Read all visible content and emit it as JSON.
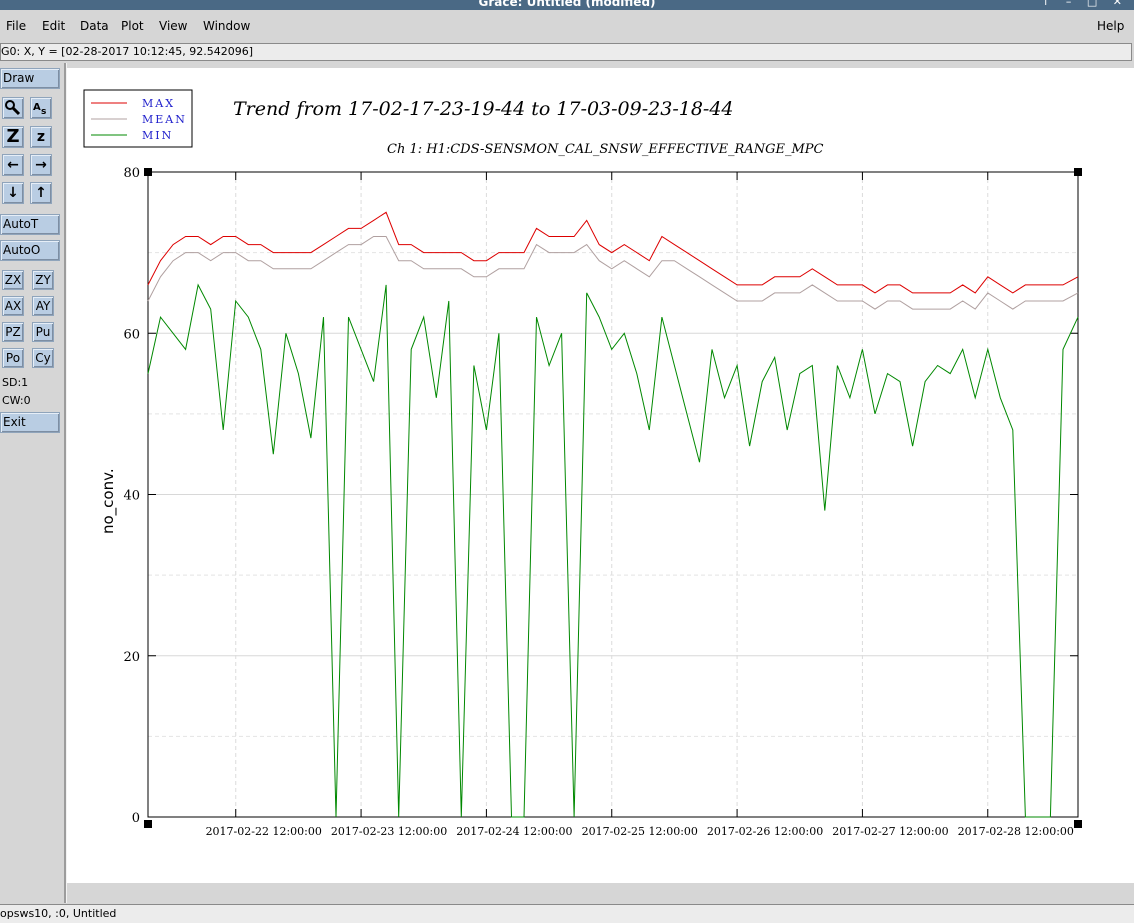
{
  "window": {
    "title": "Grace: Untitled (modified)",
    "controls": "↑ – □ ✕"
  },
  "menu": [
    "File",
    "Edit",
    "Data",
    "Plot",
    "View",
    "Window",
    "Help"
  ],
  "locator": "G0: X, Y = [02-28-2017 10:12:45, 92.542096]",
  "toolbar": {
    "draw": "Draw",
    "autoT": "AutoT",
    "autoO": "AutoO",
    "zoom_row": [
      "Z",
      "z"
    ],
    "arrows_h": [
      "←",
      "→"
    ],
    "arrows_v": [
      "↓",
      "↑"
    ],
    "zx": "ZX",
    "zy": "ZY",
    "ax": "AX",
    "ay": "AY",
    "pz": "PZ",
    "pu": "Pu",
    "po": "Po",
    "cy": "Cy",
    "sd": "SD:1",
    "cw": "CW:0",
    "exit": "Exit",
    "icon_names": [
      "magnifier-icon",
      "text-label-icon"
    ]
  },
  "status": "opsws10, :0, Untitled",
  "colors": {
    "max": "#dd0000",
    "mean": "#b0a0a0",
    "min": "#008800",
    "toolbar_button": "#b9cde3",
    "title_bar": "#4a6985"
  },
  "chart_data": {
    "type": "line",
    "title": "Trend from 17-02-17-23-19-44 to 17-03-09-23-18-44",
    "subtitle": "Ch 1: H1:CDS-SENSMON_CAL_SNSW_EFFECTIVE_RANGE_MPC",
    "xlabel": "",
    "ylabel": "no_conv.",
    "xlim": [
      0.0,
      7.42
    ],
    "ylim": [
      0,
      80
    ],
    "y_ticks": [
      0,
      20,
      40,
      60,
      80
    ],
    "x_tick_labels": [
      "2017-02-22 12:00:00",
      "2017-02-23 12:00:00",
      "2017-02-24 12:00:00",
      "2017-02-25 12:00:00",
      "2017-02-26 12:00:00",
      "2017-02-27 12:00:00",
      "2017-02-28 12:00:00"
    ],
    "x_tick_values": [
      0.7,
      1.7,
      2.7,
      3.7,
      4.7,
      5.7,
      6.7
    ],
    "grid": true,
    "legend_position": "top-left",
    "series": [
      {
        "name": "MAX",
        "x": [
          0.0,
          0.1,
          0.2,
          0.3,
          0.4,
          0.5,
          0.6,
          0.7,
          0.8,
          0.9,
          1.0,
          1.1,
          1.2,
          1.3,
          1.4,
          1.5,
          1.6,
          1.7,
          1.8,
          1.9,
          2.0,
          2.1,
          2.2,
          2.3,
          2.4,
          2.5,
          2.6,
          2.7,
          2.8,
          2.9,
          3.0,
          3.1,
          3.2,
          3.3,
          3.4,
          3.5,
          3.6,
          3.7,
          3.8,
          3.9,
          4.0,
          4.1,
          4.2,
          4.3,
          4.4,
          4.5,
          4.6,
          4.7,
          4.8,
          4.9,
          5.0,
          5.1,
          5.2,
          5.3,
          5.4,
          5.5,
          5.6,
          5.7,
          5.8,
          5.9,
          6.0,
          6.1,
          6.2,
          6.3,
          6.4,
          6.5,
          6.6,
          6.7,
          6.8,
          6.9,
          7.0,
          7.1,
          7.2,
          7.3,
          7.42
        ],
        "values": [
          66,
          69,
          71,
          72,
          72,
          71,
          72,
          72,
          71,
          71,
          70,
          70,
          70,
          70,
          71,
          72,
          73,
          73,
          74,
          75,
          71,
          71,
          70,
          70,
          70,
          70,
          69,
          69,
          70,
          70,
          70,
          73,
          72,
          72,
          72,
          74,
          71,
          70,
          71,
          70,
          69,
          72,
          71,
          70,
          69,
          68,
          67,
          66,
          66,
          66,
          67,
          67,
          67,
          68,
          67,
          66,
          66,
          66,
          65,
          66,
          66,
          65,
          65,
          65,
          65,
          66,
          65,
          67,
          66,
          65,
          66,
          66,
          66,
          66,
          67
        ]
      },
      {
        "name": "MEAN",
        "x": [
          0.0,
          0.1,
          0.2,
          0.3,
          0.4,
          0.5,
          0.6,
          0.7,
          0.8,
          0.9,
          1.0,
          1.1,
          1.2,
          1.3,
          1.4,
          1.5,
          1.6,
          1.7,
          1.8,
          1.9,
          2.0,
          2.1,
          2.2,
          2.3,
          2.4,
          2.5,
          2.6,
          2.7,
          2.8,
          2.9,
          3.0,
          3.1,
          3.2,
          3.3,
          3.4,
          3.5,
          3.6,
          3.7,
          3.8,
          3.9,
          4.0,
          4.1,
          4.2,
          4.3,
          4.4,
          4.5,
          4.6,
          4.7,
          4.8,
          4.9,
          5.0,
          5.1,
          5.2,
          5.3,
          5.4,
          5.5,
          5.6,
          5.7,
          5.8,
          5.9,
          6.0,
          6.1,
          6.2,
          6.3,
          6.4,
          6.5,
          6.6,
          6.7,
          6.8,
          6.9,
          7.0,
          7.1,
          7.2,
          7.3,
          7.42
        ],
        "values": [
          64,
          67,
          69,
          70,
          70,
          69,
          70,
          70,
          69,
          69,
          68,
          68,
          68,
          68,
          69,
          70,
          71,
          71,
          72,
          72,
          69,
          69,
          68,
          68,
          68,
          68,
          67,
          67,
          68,
          68,
          68,
          71,
          70,
          70,
          70,
          71,
          69,
          68,
          69,
          68,
          67,
          69,
          69,
          68,
          67,
          66,
          65,
          64,
          64,
          64,
          65,
          65,
          65,
          66,
          65,
          64,
          64,
          64,
          63,
          64,
          64,
          63,
          63,
          63,
          63,
          64,
          63,
          65,
          64,
          63,
          64,
          64,
          64,
          64,
          65
        ]
      },
      {
        "name": "MIN",
        "x": [
          0.0,
          0.1,
          0.2,
          0.3,
          0.4,
          0.5,
          0.6,
          0.7,
          0.8,
          0.9,
          1.0,
          1.1,
          1.2,
          1.3,
          1.4,
          1.5,
          1.6,
          1.7,
          1.8,
          1.9,
          2.0,
          2.1,
          2.2,
          2.3,
          2.4,
          2.5,
          2.6,
          2.7,
          2.8,
          2.9,
          3.0,
          3.1,
          3.2,
          3.3,
          3.4,
          3.5,
          3.6,
          3.7,
          3.8,
          3.9,
          4.0,
          4.1,
          4.2,
          4.3,
          4.4,
          4.5,
          4.6,
          4.7,
          4.8,
          4.9,
          5.0,
          5.1,
          5.2,
          5.3,
          5.4,
          5.5,
          5.6,
          5.7,
          5.8,
          5.9,
          6.0,
          6.1,
          6.2,
          6.3,
          6.4,
          6.5,
          6.6,
          6.7,
          6.8,
          6.9,
          7.0,
          7.1,
          7.2,
          7.3,
          7.42
        ],
        "values": [
          55,
          62,
          60,
          58,
          66,
          63,
          48,
          64,
          62,
          58,
          45,
          60,
          55,
          47,
          62,
          0,
          62,
          58,
          54,
          66,
          0,
          58,
          62,
          52,
          64,
          0,
          56,
          48,
          60,
          0,
          0,
          62,
          56,
          60,
          0,
          65,
          62,
          58,
          60,
          55,
          48,
          62,
          56,
          50,
          44,
          58,
          52,
          56,
          46,
          54,
          57,
          48,
          55,
          56,
          38,
          56,
          52,
          58,
          50,
          55,
          54,
          46,
          54,
          56,
          55,
          58,
          52,
          58,
          52,
          48,
          0,
          0,
          0,
          58,
          62
        ]
      }
    ]
  }
}
